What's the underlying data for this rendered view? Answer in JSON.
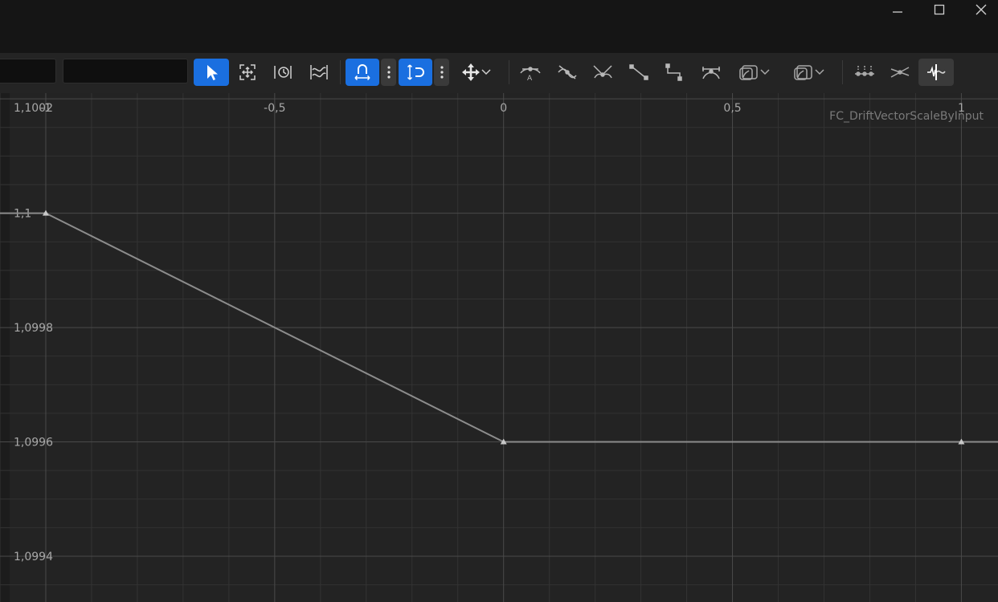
{
  "window": {
    "controls": {
      "minimize_icon": "minimize-icon",
      "maximize_icon": "maximize-icon",
      "close_icon": "close-icon"
    }
  },
  "toolbar": {
    "field_left_value": "",
    "field_search_value": "",
    "tools": [
      "select-arrow-icon",
      "frame-icon",
      "retime-icon",
      "normalize-icon",
      "snap-magnet-icon",
      "more-options-icon",
      "snap-vertical-icon",
      "more-options-icon",
      "move-icon",
      "chevron-down-icon",
      "tangent-auto-icon",
      "tangent-user-icon",
      "tangent-break-icon",
      "tangent-linear-icon",
      "tangent-constant-icon",
      "tangent-weighted-icon",
      "pre-infinity-icon",
      "post-infinity-icon",
      "flatten-icon",
      "straighten-icon",
      "curve-filter-icon"
    ],
    "colors": {
      "accent": "#1a6fe0",
      "background": "#242424"
    }
  },
  "graph": {
    "curve_name": "FC_DriftVectorScaleByInput",
    "x_tick_labels": [
      "-1",
      "-0,5",
      "0",
      "0,5",
      "1"
    ],
    "y_tick_labels": [
      "1,1002",
      "1,1",
      "1,0998",
      "1,0996",
      "1,0994"
    ],
    "colors": {
      "grid_major": "#4a4a4a",
      "grid_minor": "#333333",
      "curve": "#8c8c8c",
      "background": "#232323"
    }
  },
  "chart_data": {
    "type": "line",
    "series": [
      {
        "values": [
          {
            "x": -1,
            "y": 1.1
          },
          {
            "x": 0,
            "y": 1.0996
          },
          {
            "x": 1,
            "y": 1.0996
          }
        ]
      }
    ],
    "xlim": [
      -1.1,
      1.08
    ],
    "ylim": [
      1.09932,
      1.10021
    ],
    "grid": true
  }
}
